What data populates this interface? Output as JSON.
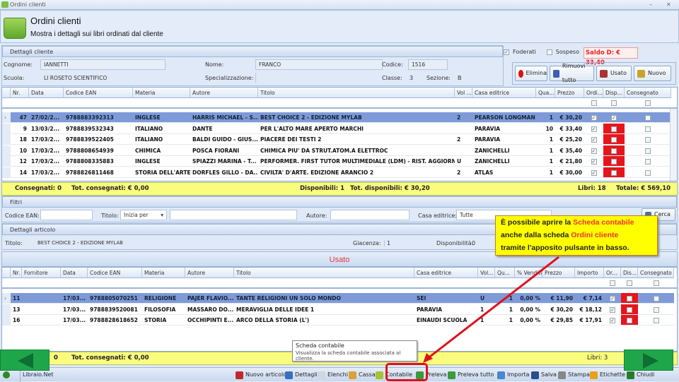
{
  "window": {
    "title": "Ordini clienti"
  },
  "header": {
    "title": "Ordini clienti",
    "subtitle": "Mostra i dettagli sui libri ordinati dal cliente"
  },
  "cliente": {
    "panel_title": "Dettagli cliente",
    "cognome_label": "Cognome:",
    "cognome": "IANNETTI",
    "nome_label": "Nome:",
    "nome": "FRANCO",
    "codice_label": "Codice:",
    "codice": "1516",
    "scuola_label": "Scuola:",
    "scuola": "LI ROSETO SCIENTIFICO",
    "specializzazione_label": "Specializzazione:",
    "specializzazione": "",
    "classe_label": "Classe:",
    "classe": "3",
    "sezione_label": "Sezione:",
    "sezione": "B",
    "foderati_label": "Foderati",
    "foderati_checked": true,
    "sospeso_label": "Sospeso",
    "sospeso_checked": false,
    "saldo": "Saldo D: € 33,40"
  },
  "actions": {
    "elimina": "Elimina",
    "rimuovi": "Rimuovi tutto",
    "usato": "Usato",
    "nuovo": "Nuovo"
  },
  "orders": {
    "columns": [
      "Nr.",
      "Data",
      "Codice EAN",
      "Materia",
      "Autore",
      "Titolo",
      "Vol ...",
      "Casa editrice",
      "Qua...",
      "Prezzo",
      "Ordi...",
      "Disp...",
      "Consegnato"
    ],
    "rows": [
      {
        "nr": "47",
        "data": "27/02/2...",
        "ean": "9788883392313",
        "materia": "INGLESE",
        "autore": "HARRIS MICHAEL - S...",
        "titolo": "BEST CHOICE 2 - EDIZIONE MYLAB",
        "vol": "2",
        "casa": "PEARSON LONGMAN",
        "qta": "1",
        "prezzo": "€ 30,20",
        "ordinato": true,
        "disponibile": true,
        "consegnato": false,
        "selected": true
      },
      {
        "nr": "9",
        "data": "13/03/2...",
        "ean": "9788839532343",
        "materia": "ITALIANO",
        "autore": "DANTE",
        "titolo": "PER L'ALTO MARE APERTO MARCHI",
        "vol": "",
        "casa": "PARAVIA",
        "qta": "10",
        "prezzo": "€ 33,40",
        "ordinato": true,
        "disponibile": false,
        "consegnato": false
      },
      {
        "nr": "18",
        "data": "17/03/2...",
        "ean": "9788839522405",
        "materia": "ITALIANO",
        "autore": "BALDI GUIDO - GIUS...",
        "titolo": "PIACERE DEI TESTI 2",
        "vol": "2",
        "casa": "PARAVIA",
        "qta": "1",
        "prezzo": "€ 25,20",
        "ordinato": true,
        "disponibile": false,
        "consegnato": false
      },
      {
        "nr": "10",
        "data": "17/03/2...",
        "ean": "9788808654939",
        "materia": "CHIMICA",
        "autore": "POSCA FIORANI",
        "titolo": "CHIMICA PIU' DA STRUT.ATOM.A ELETTROC",
        "vol": "",
        "casa": "ZANICHELLI",
        "qta": "1",
        "prezzo": "€ 35,40",
        "ordinato": true,
        "disponibile": false,
        "consegnato": false
      },
      {
        "nr": "12",
        "data": "17/03/2...",
        "ean": "9788808335883",
        "materia": "INGLESE",
        "autore": "SPIAZZI MARINA - T...",
        "titolo": "PERFORMER. FIRST TUTOR MULTIMEDIALE (LDM) - RIST. AGGIORN...",
        "vol": "U",
        "casa": "ZANICHELLI",
        "qta": "1",
        "prezzo": "€ 21,80",
        "ordinato": true,
        "disponibile": false,
        "consegnato": false
      },
      {
        "nr": "14",
        "data": "17/03/2...",
        "ean": "9788826811468",
        "materia": "STORIA DELL'ARTE",
        "autore": "DORFLES GILLO - DA...",
        "titolo": "CIVILTA' D'ARTE. EDIZIONE ARANCIO 2",
        "vol": "2",
        "casa": "ATLAS",
        "qta": "1",
        "prezzo": "€ 30,00",
        "ordinato": true,
        "disponibile": false,
        "consegnato": false
      }
    ],
    "summary": {
      "consegnati": "Consegnati: 0",
      "tot_consegnati": "Tot. consegnati: € 0,00",
      "disponibili": "Disponibili: 1",
      "tot_disponibili": "Tot. disponibili: € 30,20",
      "libri": "Libri: 18",
      "totale": "Totale: € 569,10"
    }
  },
  "filtri": {
    "panel_title": "Filtri",
    "ean_label": "Codice EAN:",
    "ean": "",
    "titolo_label": "Titolo:",
    "titolo_mode": "Inizia per",
    "titolo": "",
    "autore_label": "Autore:",
    "autore": "",
    "casa_label": "Casa editrice:",
    "casa": "Tutte",
    "cerca": "Cerca"
  },
  "articolo": {
    "panel_title": "Dettagli articolo",
    "titolo_label": "Titolo:",
    "titolo": "BEST CHOICE 2 - EDIZIONE MYLAB",
    "giacenza_label": "Giacenza:",
    "giacenza": "1",
    "disponibilita_label": "Disponibilità:",
    "disponibilita": "0"
  },
  "usato": {
    "title": "Usato",
    "columns": [
      "Nr.",
      "Fornitore",
      "Data",
      "Codice EAN",
      "Materia",
      "Autore",
      "Titolo",
      "Casa editrice",
      "Vol...",
      "Qu...",
      "% Vendita",
      "Prezzo",
      "Importo",
      "Or...",
      "Dis...",
      "Consegnato"
    ],
    "rows": [
      {
        "nr": "11",
        "fornitore": "",
        "data": "17/03...",
        "ean": "9788805070251",
        "materia": "RELIGIONE",
        "autore": "PAJER FLAVIO...",
        "titolo": "TANTE RELIGIONI UN SOLO MONDO",
        "casa": "SEI",
        "vol": "U",
        "qta": "1",
        "perc": "0,00 %",
        "prezzo": "€ 11,90",
        "importo": "€ 7,14",
        "ordinato": true,
        "disponibile": false,
        "consegnato": false,
        "selected": true
      },
      {
        "nr": "13",
        "fornitore": "",
        "data": "17/03...",
        "ean": "9788839520081",
        "materia": "FILOSOFIA",
        "autore": "MASSARO DO...",
        "titolo": "MERAVIGLIA DELLE IDEE 1",
        "casa": "PARAVIA",
        "vol": "1",
        "qta": "1",
        "perc": "0,00 %",
        "prezzo": "€ 30,20",
        "importo": "€ 18,12",
        "ordinato": true,
        "disponibile": false,
        "consegnato": false
      },
      {
        "nr": "16",
        "fornitore": "",
        "data": "17/03...",
        "ean": "9788828618652",
        "materia": "STORIA",
        "autore": "OCCHIPINTI E...",
        "titolo": "ARCO DELLA STORIA (L')",
        "casa": "EINAUDI SCUOLA",
        "vol": "1",
        "qta": "1",
        "perc": "0,00 %",
        "prezzo": "€ 29,85",
        "importo": "€ 17,91",
        "ordinato": true,
        "disponibile": false,
        "consegnato": false
      }
    ],
    "summary": {
      "consegnati": "0",
      "tot_consegnati": "Tot. consegnati: € 0,00",
      "libri": "Libri: 3"
    }
  },
  "tooltip": {
    "title": "Scheda contabile",
    "text": "Visualizza la scheda contabile associata al cliente."
  },
  "callout": {
    "l1a": "È possibile aprire la ",
    "l1b": "Scheda contabile",
    "l2a": "anche dalla scheda ",
    "l2b": "Ordini cliente",
    "l3": "tramite l'apposito pulsante in basso."
  },
  "statusbar": {
    "app": "Libraio.Net",
    "tools": [
      {
        "label": "Nuovo articolo",
        "icon": "new-item-icon",
        "color": "#c0282d"
      },
      {
        "label": "Dettagli",
        "icon": "magnifier-icon",
        "color": "#3a6fc0"
      },
      {
        "label": "Elenchi",
        "icon": "list-icon",
        "color": "#cfd6e0"
      },
      {
        "label": "Cassa",
        "icon": "euro-icon",
        "color": "#d9a23a"
      },
      {
        "label": "Contabile",
        "icon": "ledger-icon",
        "color": "#a5c23a"
      },
      {
        "label": "Preleva",
        "icon": "withdraw-icon",
        "color": "#3c9a3c"
      },
      {
        "label": "Preleva tutto",
        "icon": "withdraw-all-icon",
        "color": "#3c9a3c"
      },
      {
        "label": "Importa",
        "icon": "import-icon",
        "color": "#4a86c8"
      },
      {
        "label": "Salva",
        "icon": "save-icon",
        "color": "#2b4d8c"
      },
      {
        "label": "Stampa",
        "icon": "print-icon",
        "color": "#888888"
      },
      {
        "label": "Etichette",
        "icon": "label-icon",
        "color": "#e8a020"
      },
      {
        "label": "Chiudi",
        "icon": "close-icon",
        "color": "#2a7a2a"
      }
    ]
  },
  "colors": {
    "selected_row": "#7f9ad8",
    "unavailable": "#e8141c",
    "summary_bar": "#fafc7e",
    "nav_green": "#1fa64a",
    "highlight": "#e33333"
  }
}
